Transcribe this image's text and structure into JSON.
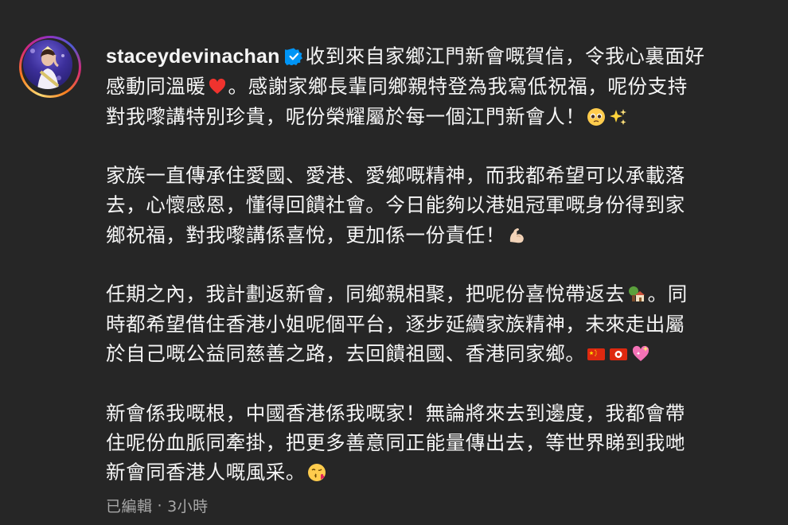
{
  "post": {
    "username": "stacey.devinachan",
    "username_display": "staceydevinachan",
    "verified_icon": "verified-badge-icon",
    "caption": {
      "p1": {
        "line1": "收到來自家鄉江門新會嘅賀信，令我心裏面好",
        "line2a": "感動同溫暖",
        "line2b": "。感謝家鄉長輩同鄉親特登為我寫低祝福，呢份支持",
        "line3a": "對我嚟講特別珍貴，呢份榮耀屬於每一個江門新會人！"
      },
      "p2": {
        "line1": "家族一直傳承住愛國、愛港、愛鄉嘅精神，而我都希望可以承載落",
        "line2": "去，心懷感恩，懂得回饋社會。今日能夠以港姐冠軍嘅身份得到家",
        "line3a": "鄉祝福，對我嚟講係喜悅，更加係一份責任！"
      },
      "p3": {
        "line1a": "任期之內，我計劃返新會，同鄉親相聚，把呢份喜悅帶返去",
        "line1b": "。同",
        "line2": "時都希望借住香港小姐呢個平台，逐步延續家族精神，未來走出屬",
        "line3a": "於自己嘅公益同慈善之路，去回饋祖國、香港同家鄉。"
      },
      "p4": {
        "line1": "新會係我嘅根，中國香港係我嘅家！無論將來去到邊度，我都會帶",
        "line2": "住呢份血脈同牽掛，把更多善意同正能量傳出去，等世界睇到我哋",
        "line3a": "新會同香港人嘅風采。"
      }
    },
    "emojis": [
      "red-heart",
      "pleading-face",
      "sparkles",
      "flexed-biceps",
      "house-with-garden",
      "china-flag",
      "hong-kong-flag",
      "sparkling-heart",
      "face-blowing-kiss"
    ],
    "meta": {
      "edited": "已編輯",
      "separator": "·",
      "time": "3小時"
    }
  }
}
